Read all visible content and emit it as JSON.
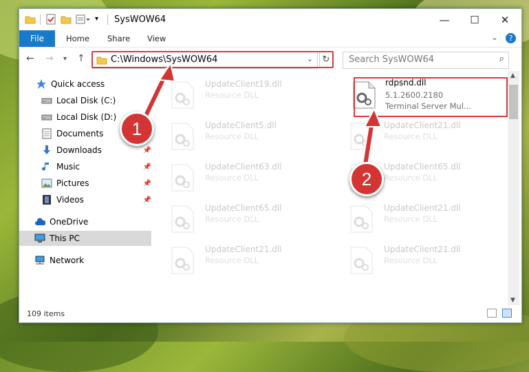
{
  "window": {
    "title": "SysWOW64"
  },
  "ribbon": {
    "file": "File",
    "home": "Home",
    "share": "Share",
    "view": "View"
  },
  "address": {
    "path": "C:\\Windows\\SysWOW64"
  },
  "search": {
    "placeholder": "Search SysWOW64"
  },
  "sidebar": {
    "items": [
      {
        "label": "Quick access",
        "icon": "star-icon"
      },
      {
        "label": "Local Disk (C:)",
        "icon": "drive-icon"
      },
      {
        "label": "Local Disk (D:)",
        "icon": "drive-icon"
      },
      {
        "label": "Documents",
        "icon": "documents-icon"
      },
      {
        "label": "Downloads",
        "icon": "downloads-icon"
      },
      {
        "label": "Music",
        "icon": "music-icon"
      },
      {
        "label": "Pictures",
        "icon": "pictures-icon"
      },
      {
        "label": "Videos",
        "icon": "videos-icon"
      },
      {
        "label": "OneDrive",
        "icon": "cloud-icon"
      },
      {
        "label": "This PC",
        "icon": "computer-icon"
      },
      {
        "label": "Network",
        "icon": "network-icon"
      }
    ]
  },
  "files": [
    {
      "name": "UpdateClient19.dll",
      "type": "Resource DLL"
    },
    {
      "name": "rdpsnd.dll",
      "version": "5.1.2600.2180",
      "desc": "Terminal Server Mul..."
    },
    {
      "name": "UpdateClient5.dll",
      "type": "Resource DLL"
    },
    {
      "name": "UpdateClient21.dll",
      "type": "Resource DLL"
    },
    {
      "name": "UpdateClient63.dll",
      "type": "Resource DLL"
    },
    {
      "name": "UpdateClient65.dll",
      "type": "Resource DLL"
    },
    {
      "name": "UpdateClient65.dll",
      "type": "Resource DLL"
    },
    {
      "name": "UpdateClient21.dll",
      "type": "Resource DLL"
    },
    {
      "name": "UpdateClient21.dll",
      "type": "Resource DLL"
    },
    {
      "name": "UpdateClient21.dll",
      "type": "Resource DLL"
    }
  ],
  "status": {
    "count": "109 items"
  },
  "annotations": {
    "step1": "1",
    "step2": "2"
  },
  "colors": {
    "accent": "#1979ca",
    "highlight": "#d9393b"
  }
}
